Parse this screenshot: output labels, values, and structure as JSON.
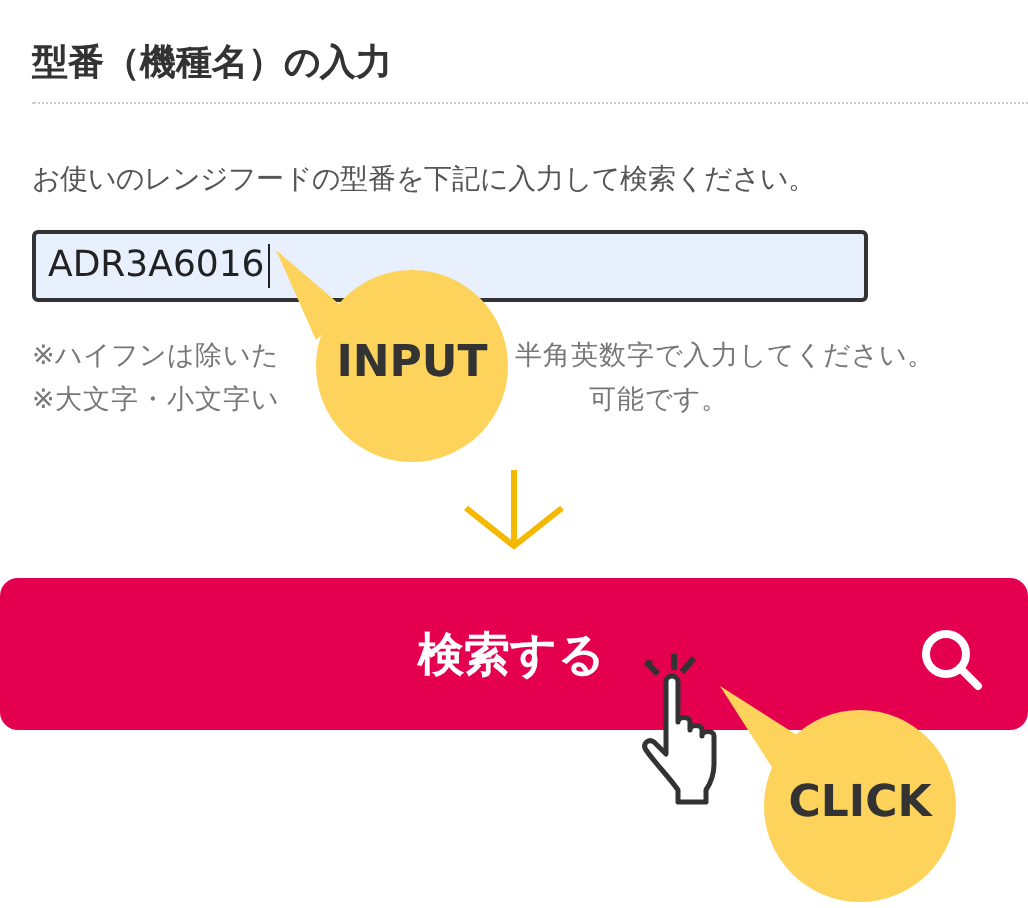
{
  "heading": "型番（機種名）の入力",
  "instruction": "お使いのレンジフードの型番を下記に入力して検索ください。",
  "model_input": {
    "value": "ADR3A6016"
  },
  "notes": [
    {
      "segments": [
        "※ハイフンは除いた",
        "半角英数字で入力してください。"
      ]
    },
    {
      "segments": [
        "※大文字・小文字い",
        "可能です。"
      ]
    }
  ],
  "search_button": {
    "label": "検索する"
  },
  "callouts": [
    {
      "label": "INPUT"
    },
    {
      "label": "CLICK"
    }
  ]
}
